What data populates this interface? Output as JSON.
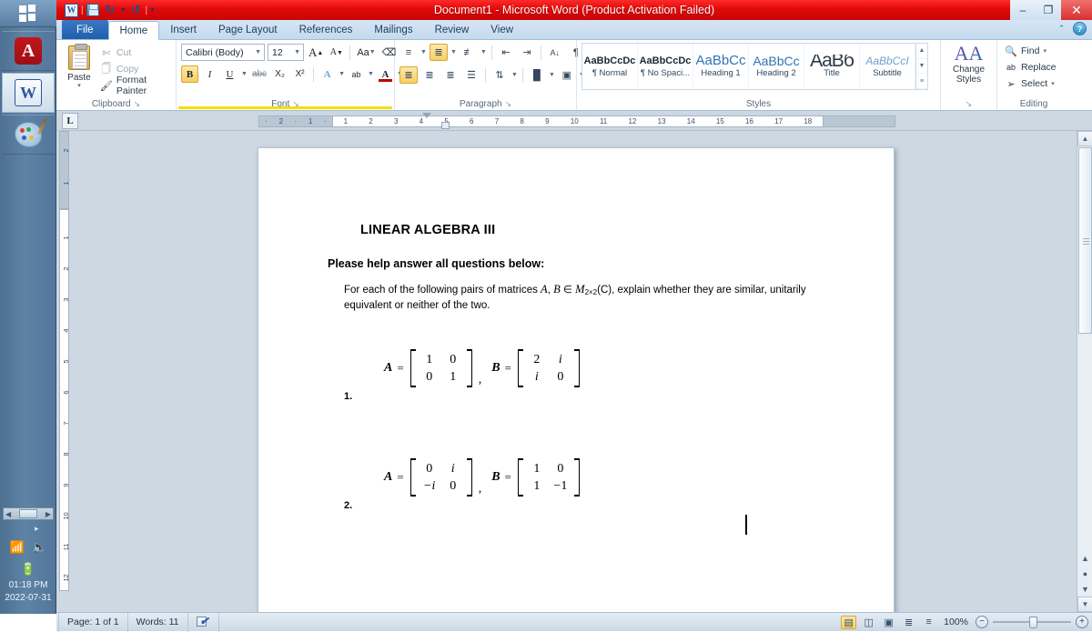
{
  "titlebar": {
    "title": "Document1  -  Microsoft Word (Product Activation Failed)",
    "qat": {
      "word_icon": "word-icon",
      "save_icon": "save-icon",
      "undo_icon": "undo-icon",
      "redo_icon": "redo-icon",
      "customize_icon": "customize-quick-access-icon"
    },
    "controls": {
      "minimize": "–",
      "maximize": "❐",
      "close": "✕"
    },
    "accent_red": "#d81414"
  },
  "tabs": [
    {
      "label": "File",
      "kind": "file"
    },
    {
      "label": "Home",
      "kind": "active"
    },
    {
      "label": "Insert",
      "kind": "normal"
    },
    {
      "label": "Page Layout",
      "kind": "normal"
    },
    {
      "label": "References",
      "kind": "normal"
    },
    {
      "label": "Mailings",
      "kind": "normal"
    },
    {
      "label": "Review",
      "kind": "normal"
    },
    {
      "label": "View",
      "kind": "normal"
    }
  ],
  "ribbon_help": {
    "collapse": "⌃",
    "help": "?"
  },
  "ribbon": {
    "clipboard": {
      "group_title": "Clipboard",
      "paste_label": "Paste",
      "paste_caret": "▾",
      "cut_label": "Cut",
      "copy_label": "Copy",
      "format_painter_label": "Format Painter",
      "dialog_launcher": "↘"
    },
    "font": {
      "group_title": "Font",
      "font_name": "Calibri (Body)",
      "font_size": "12",
      "grow_font": "A",
      "shrink_font": "A",
      "change_case": "Aa",
      "clear_formatting": "⌫",
      "bold": "B",
      "italic": "I",
      "underline": "U",
      "strikethrough": "abc",
      "subscript": "X₂",
      "superscript": "X²",
      "text_effects": "A",
      "highlight": "ab",
      "font_color": "A",
      "dialog_launcher": "↘"
    },
    "paragraph": {
      "group_title": "Paragraph",
      "bullets": "bullets-icon",
      "numbering": "numbering-icon",
      "multilevel": "multilevel-list-icon",
      "decrease_indent": "decrease-indent-icon",
      "increase_indent": "increase-indent-icon",
      "sort": "sort-icon",
      "show_marks": "¶",
      "align_left": "align-left-icon",
      "align_center": "align-center-icon",
      "align_right": "align-right-icon",
      "justify": "justify-icon",
      "line_spacing": "line-spacing-icon",
      "shading": "shading-icon",
      "borders": "borders-icon",
      "dialog_launcher": "↘"
    },
    "styles": {
      "group_title": "Styles",
      "items": [
        {
          "preview": "AaBbCcDc",
          "name": "¶ Normal"
        },
        {
          "preview": "AaBbCcDc",
          "name": "¶ No Spaci..."
        },
        {
          "preview": "AaBbCс",
          "name": "Heading 1"
        },
        {
          "preview": "AaBbCc",
          "name": "Heading 2"
        },
        {
          "preview": "AaBб",
          "name": "Title"
        },
        {
          "preview": "AaBbCcI",
          "name": "Subtitle"
        }
      ],
      "scroll_up": "▲",
      "scroll_down": "▼",
      "more": "≡",
      "dialog_launcher": "↘"
    },
    "change_styles": {
      "label_line1": "Change",
      "label_line2": "Styles",
      "caret": "▾"
    },
    "editing": {
      "group_title": "Editing",
      "find_label": "Find",
      "find_caret": "▾",
      "replace_label": "Replace",
      "select_label": "Select",
      "select_caret": "▾"
    }
  },
  "ruler": {
    "tab_stop_marker": "L",
    "left_ticks": [
      "2",
      "1"
    ],
    "page_ticks": [
      "1",
      "2",
      "3",
      "4",
      "5",
      "6",
      "7",
      "8",
      "9",
      "10",
      "11",
      "12",
      "13",
      "14",
      "15",
      "16",
      "17",
      "18"
    ],
    "vertical_margin_ticks": [
      "2",
      "1"
    ],
    "vertical_ticks": [
      "1",
      "2",
      "3",
      "4",
      "5",
      "6",
      "7",
      "8",
      "9",
      "10",
      "11",
      "12"
    ]
  },
  "document": {
    "heading": "LINEAR ALGEBRA III",
    "lead": "Please help answer all questions below:",
    "body_prefix": "For each of the following pairs of matrices ",
    "body_var_a": "A",
    "body_comma": ", ",
    "body_var_b": "B",
    "body_in": " ∈ ",
    "body_var_m": "M",
    "body_sub": "2×2",
    "body_paren": "(C)",
    "body_suffix": ", explain whether they are similar, unitarily equivalent or neither of the two.",
    "questions": [
      {
        "number": "1.",
        "a_label": "A",
        "a_eq": "=",
        "a_matrix": [
          [
            "1",
            "0"
          ],
          [
            "0",
            "1"
          ]
        ],
        "a_italic": [
          [
            false,
            false
          ],
          [
            false,
            false
          ]
        ],
        "separator": ",",
        "b_label": "B",
        "b_eq": "=",
        "b_matrix": [
          [
            "2",
            "i"
          ],
          [
            "i",
            "0"
          ]
        ],
        "b_italic": [
          [
            false,
            true
          ],
          [
            true,
            false
          ]
        ]
      },
      {
        "number": "2.",
        "a_label": "A",
        "a_eq": "=",
        "a_matrix": [
          [
            "0",
            "i"
          ],
          [
            "−i",
            "0"
          ]
        ],
        "a_italic": [
          [
            false,
            true
          ],
          [
            true,
            false
          ]
        ],
        "separator": ",",
        "b_label": "B",
        "b_eq": "=",
        "b_matrix": [
          [
            "1",
            "0"
          ],
          [
            "1",
            "−1"
          ]
        ],
        "b_italic": [
          [
            false,
            false
          ],
          [
            false,
            false
          ]
        ]
      }
    ]
  },
  "statusbar": {
    "page": "Page: 1 of 1",
    "words": "Words: 11",
    "proofing_icon": "spell-check-icon",
    "views": [
      {
        "name": "print-layout-view",
        "glyph": "▤",
        "active": true
      },
      {
        "name": "full-screen-reading-view",
        "glyph": "◫",
        "active": false
      },
      {
        "name": "web-layout-view",
        "glyph": "▣",
        "active": false
      },
      {
        "name": "outline-view",
        "glyph": "≣",
        "active": false
      },
      {
        "name": "draft-view",
        "glyph": "≡",
        "active": false
      }
    ],
    "zoom": "100%",
    "zoom_out": "−",
    "zoom_in": "+"
  },
  "taskbar": {
    "start_icon": "windows-start-icon",
    "items": [
      {
        "name": "taskbar-item-acrobat",
        "icon": "adobe-acrobat-icon",
        "label": "A"
      },
      {
        "name": "taskbar-item-word",
        "icon": "microsoft-word-icon",
        "label": "W"
      },
      {
        "name": "taskbar-item-paint",
        "icon": "paint-icon",
        "label": ""
      }
    ],
    "tray": {
      "show_hidden": "▸",
      "network_icon": "network-signal-icon",
      "volume_icon": "volume-icon",
      "battery_icon": "battery-icon",
      "time": "01:18 PM",
      "date": "2022-07-31"
    }
  }
}
